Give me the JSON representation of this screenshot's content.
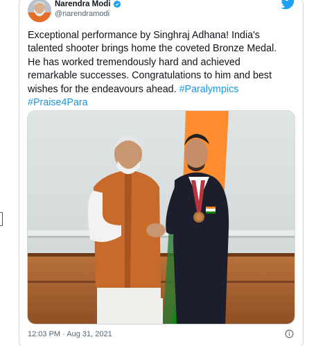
{
  "tweet": {
    "author_name": "Narendra Modi",
    "author_handle": "@narendramodi",
    "verified": true,
    "text_lines": [
      "Exceptional performance by Singhraj Adhana! India's",
      "talented shooter brings home the coveted Bronze Medal.",
      "He has worked tremendously hard and achieved",
      "remarkable successes. Congratulations to him and best",
      "wishes for the endeavours ahead. "
    ],
    "hashtags": [
      "#Paralympics",
      "#Praise4Para"
    ],
    "timestamp": "12:03 PM · Aug 31, 2021"
  },
  "icons": {
    "logo": "twitter-bird-icon",
    "verified": "verified-badge-icon",
    "info": "info-icon"
  },
  "colors": {
    "twitter_blue": "#1da1f2",
    "hashtag": "#1b95e0",
    "text": "#0f1419",
    "muted": "#536471",
    "border": "#cfd9de"
  }
}
